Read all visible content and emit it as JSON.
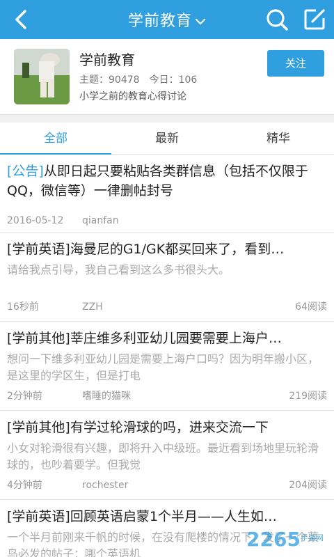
{
  "topbar": {
    "title": "学前教育",
    "accent": "#2f9fe0"
  },
  "forum": {
    "name": "学前教育",
    "topics_label": "主题：90478",
    "today_label": "今日：106",
    "description": "小学之前的教育心得讨论",
    "follow_label": "关注"
  },
  "tabs": [
    {
      "label": "全部",
      "active": true
    },
    {
      "label": "最新",
      "active": false
    },
    {
      "label": "精华",
      "active": false
    }
  ],
  "posts": [
    {
      "tag": "[公告]",
      "title": "从即日起只要粘贴各类群信息（包括不仅限于QQ，微信等）一律删帖封号",
      "snippet": "",
      "time": "2016-05-12",
      "author": "qianfan",
      "views": ""
    },
    {
      "tag": "",
      "title": "[学前英语]海曼尼的G1/GK都买回来了，看到…",
      "snippet": "请给我点引导，我自己看到这么多书很头大。",
      "time": "16秒前",
      "author": "ZZH",
      "views": "64阅读"
    },
    {
      "tag": "",
      "title": "[学前其他]莘庄维多利亚幼儿园要需要上海户…",
      "snippet": "想问一下维多利亚幼儿园是需要上海户口吗？因为明年搬小区，是这里的学区生，但是打电",
      "time": "2分钟前",
      "author": "嗜睡的猫咪",
      "views": "219阅读"
    },
    {
      "tag": "",
      "title": "[学前其他]有学过轮滑球的吗，进来交流一下",
      "snippet": "小女对轮滑很有兴趣，即将升入中级班。最近看到场地里玩轮滑球的，也吵着要学。但我觉",
      "time": "4分钟前",
      "author": "rochester",
      "views": "204阅读"
    },
    {
      "tag": "",
      "title": "[学前英语]回顾英语启蒙1个半月——人生如…",
      "snippet": "一个半月前刚来千帆的时候，在没有爬楼的情况下，发了一个菜鸟必发的帖子：哪个英语机",
      "time": "",
      "author": "",
      "views": ""
    }
  ],
  "watermark": {
    "text": "2265",
    "sub": "手游网"
  }
}
